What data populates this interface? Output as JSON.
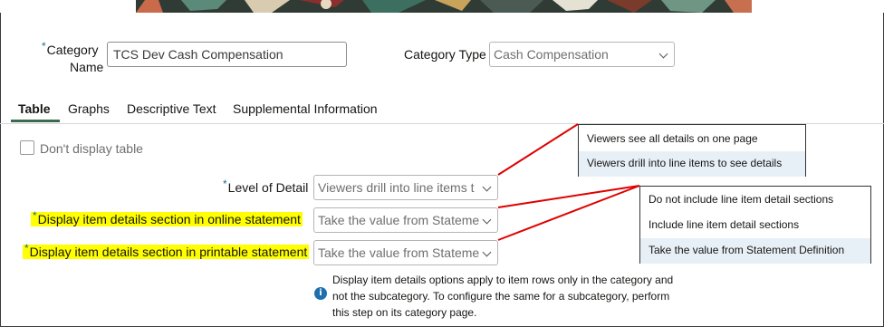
{
  "form": {
    "category_name_label_line1": "Category",
    "category_name_label_line2": "Name",
    "category_name_value": "TCS Dev Cash Compensation",
    "category_type_label": "Category Type",
    "category_type_value": "Cash Compensation",
    "required_marker": "*"
  },
  "tabs": [
    {
      "label": "Table",
      "active": true
    },
    {
      "label": "Graphs",
      "active": false
    },
    {
      "label": "Descriptive Text",
      "active": false
    },
    {
      "label": "Supplemental Information",
      "active": false
    }
  ],
  "table": {
    "dont_display_label": "Don't display table",
    "level_of_detail_label": "Level of Detail",
    "level_of_detail_value": "Viewers drill into line items t",
    "online_label": "Display item details section in online statement",
    "online_value": "Take the value from Stateme",
    "printable_label": "Display item details section in printable statement",
    "printable_value": "Take the value from Stateme",
    "info_text": "Display item details options apply to item rows only in the category and not the subcategory. To configure the same for a subcategory, perform this step on its category page."
  },
  "popup_level": {
    "options": [
      "Viewers see all details on one page",
      "Viewers drill into line items to see details"
    ],
    "selected_index": 1
  },
  "popup_display": {
    "options": [
      "Do not include line item detail sections",
      "Include line item detail sections",
      "Take the value from Statement Definition"
    ],
    "selected_index": 2
  },
  "colors": {
    "highlight": "#ffff00",
    "callout_line": "#e00000",
    "active_tab_underline": "#3a6b4e",
    "info_icon": "#1f6fad"
  },
  "icons": {
    "info": "info-icon",
    "dropdown": "chevron-down-icon",
    "checkbox": "checkbox-icon"
  }
}
